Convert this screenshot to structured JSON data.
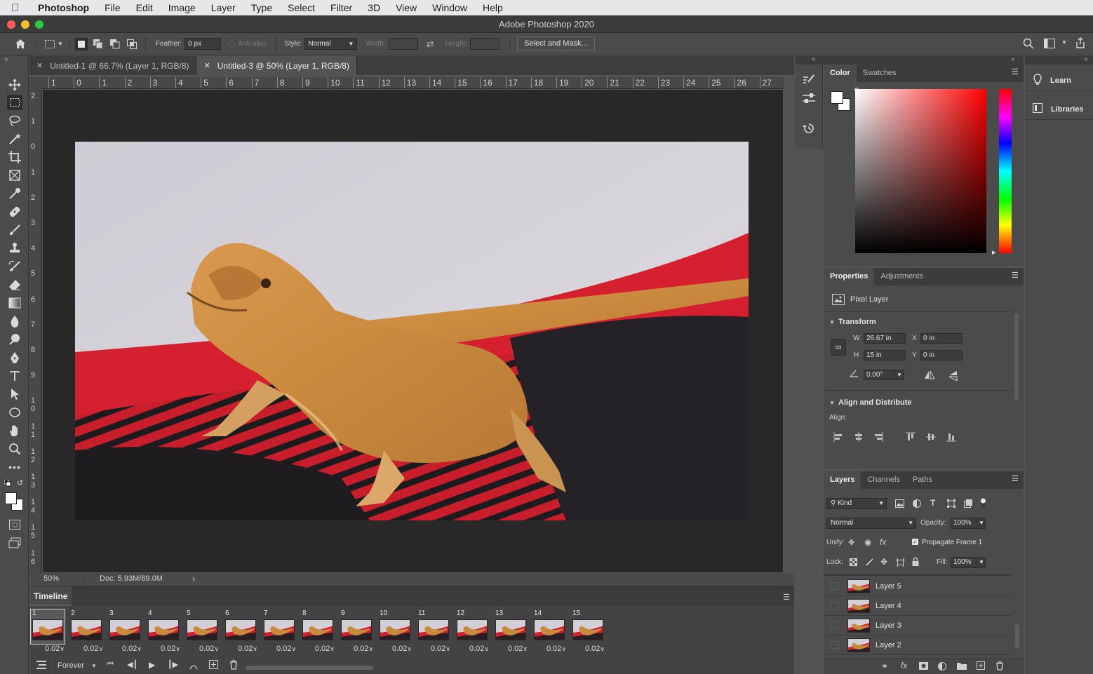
{
  "menubar": {
    "app": "Photoshop",
    "items": [
      "File",
      "Edit",
      "Image",
      "Layer",
      "Type",
      "Select",
      "Filter",
      "3D",
      "View",
      "Window",
      "Help"
    ]
  },
  "window": {
    "title": "Adobe Photoshop 2020"
  },
  "options": {
    "feather_label": "Feather:",
    "feather_value": "0 px",
    "antialias_label": "Anti-alias",
    "style_label": "Style:",
    "style_value": "Normal",
    "width_label": "Width:",
    "height_label": "Height:",
    "select_mask": "Select and Mask..."
  },
  "tabs": [
    {
      "label": "Untitled-1 @ 66.7% (Layer 1, RGB/8)",
      "active": false
    },
    {
      "label": "Untitled-3 @ 50% (Layer 1, RGB/8)",
      "active": true
    }
  ],
  "ruler": {
    "h": [
      "1",
      "0",
      "1",
      "2",
      "3",
      "4",
      "5",
      "6",
      "7",
      "8",
      "9",
      "10",
      "11",
      "12",
      "13",
      "14",
      "15",
      "16",
      "17",
      "18",
      "19",
      "20",
      "21",
      "22",
      "23",
      "24",
      "25",
      "26",
      "27"
    ],
    "v": [
      "2",
      "1",
      "0",
      "1",
      "2",
      "3",
      "4",
      "5",
      "6",
      "7",
      "8",
      "9",
      "10",
      "11",
      "12",
      "13",
      "14",
      "15",
      "16"
    ]
  },
  "status": {
    "zoom": "50%",
    "doc": "Doc: 5.93M/89.0M"
  },
  "timeline": {
    "title": "Timeline",
    "frames": [
      {
        "n": "1",
        "d": "0.02"
      },
      {
        "n": "2",
        "d": "0.02"
      },
      {
        "n": "3",
        "d": "0.02"
      },
      {
        "n": "4",
        "d": "0.02"
      },
      {
        "n": "5",
        "d": "0.02"
      },
      {
        "n": "6",
        "d": "0.02"
      },
      {
        "n": "7",
        "d": "0.02"
      },
      {
        "n": "8",
        "d": "0.02"
      },
      {
        "n": "9",
        "d": "0.02"
      },
      {
        "n": "10",
        "d": "0.02"
      },
      {
        "n": "11",
        "d": "0.02"
      },
      {
        "n": "12",
        "d": "0.02"
      },
      {
        "n": "13",
        "d": "0.02"
      },
      {
        "n": "14",
        "d": "0.02"
      },
      {
        "n": "15",
        "d": "0.02"
      }
    ],
    "loop": "Forever"
  },
  "color_panel": {
    "tabs": [
      "Color",
      "Swatches"
    ]
  },
  "properties": {
    "tabs": [
      "Properties",
      "Adjustments"
    ],
    "kind": "Pixel Layer",
    "transform_title": "Transform",
    "w_label": "W",
    "w": "26.67 in",
    "x_label": "X",
    "x": "0 in",
    "h_label": "H",
    "h": "15 in",
    "y_label": "Y",
    "y": "0 in",
    "angle": "0.00°",
    "align_title": "Align and Distribute",
    "align_label": "Align:"
  },
  "layers": {
    "tabs": [
      "Layers",
      "Channels",
      "Paths"
    ],
    "kind": "Kind",
    "blend": "Normal",
    "opacity_label": "Opacity:",
    "opacity": "100%",
    "unify_label": "Unify:",
    "propagate": "Propagate Frame 1",
    "lock_label": "Lock:",
    "fill_label": "Fill:",
    "fill": "100%",
    "items": [
      "Layer 5",
      "Layer 4",
      "Layer 3",
      "Layer 2"
    ]
  },
  "far": {
    "learn": "Learn",
    "libraries": "Libraries"
  }
}
